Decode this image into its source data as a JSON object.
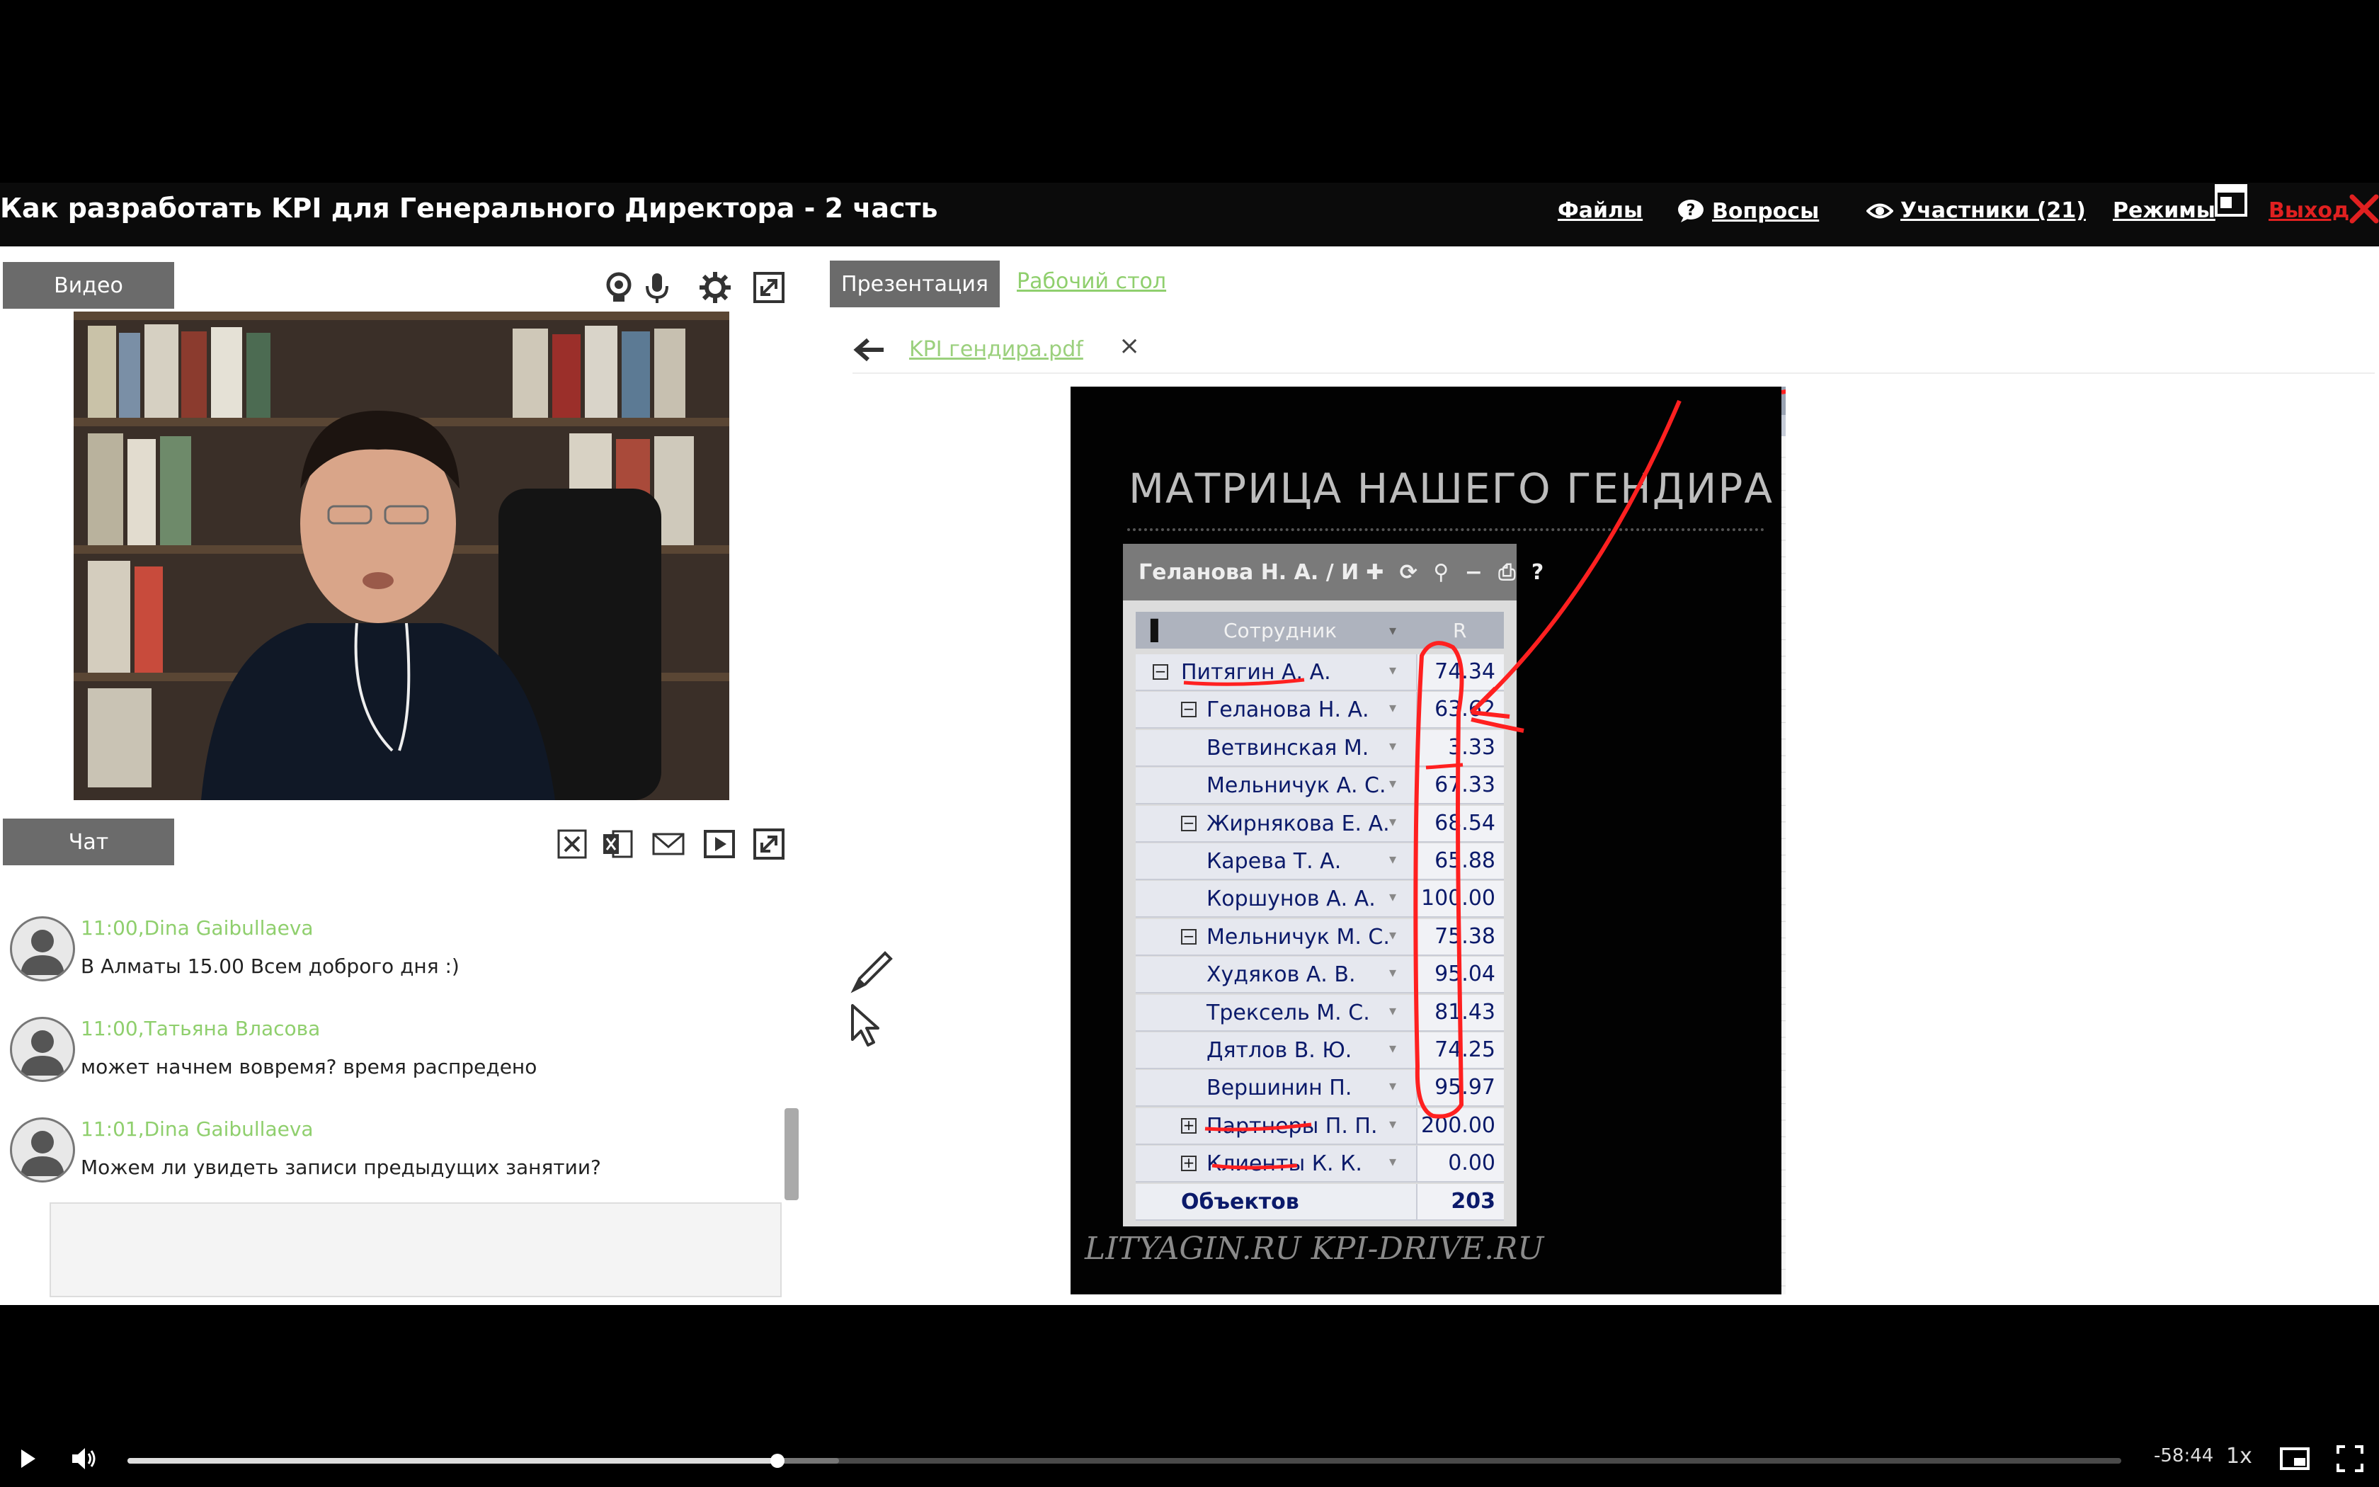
{
  "header": {
    "title": "Как разработать KPI для Генерального Директора - 2 часть",
    "files": "Файлы",
    "questions": "Вопросы",
    "participants": "Участники (21)",
    "modes": "Режимы",
    "exit": "Выход"
  },
  "video_panel": {
    "tab": "Видео"
  },
  "chat": {
    "tab": "Чат",
    "messages": [
      {
        "time": "11:00,",
        "author": "Dina Gaibullaeva",
        "text": "В Алматы 15.00 Всем доброго дня :)"
      },
      {
        "time": "11:00,",
        "author": "Татьяна Власова",
        "text": "может начнем вовремя? время распредено"
      },
      {
        "time": "11:01,",
        "author": "Dina Gaibullaeva",
        "text": "Можем ли увидеть записи предыдущих занятии?"
      }
    ]
  },
  "presentation": {
    "tab_presentation": "Презентация",
    "tab_desktop": "Рабочий стол",
    "file_name": "KPI гендира.pdf",
    "slide": {
      "title": "МАТРИЦА НАШЕГО ГЕНДИРА",
      "matrix_header": "Геланова Н. А. / И",
      "col_employee": "Сотрудник",
      "col_r": "R",
      "rows": [
        {
          "name": "Питягин А. А.",
          "value": "74.34"
        },
        {
          "name": "Геланова Н. А.",
          "value": "63.62"
        },
        {
          "name": "Ветвинская М.",
          "value": "3.33"
        },
        {
          "name": "Мельничук А. С.",
          "value": "67.33"
        },
        {
          "name": "Жирнякова Е. А.",
          "value": "68.54"
        },
        {
          "name": "Карева Т. А.",
          "value": "65.88"
        },
        {
          "name": "Коршунов А. А.",
          "value": "100.00"
        },
        {
          "name": "Мельничук М. С.",
          "value": "75.38"
        },
        {
          "name": "Худяков А. В.",
          "value": "95.04"
        },
        {
          "name": "Трексель М. С.",
          "value": "81.43"
        },
        {
          "name": "Дятлов В. Ю.",
          "value": "74.25"
        },
        {
          "name": "Вершинин П.",
          "value": "95.97"
        },
        {
          "name": "Партнеры П. П.",
          "value": "200.00"
        },
        {
          "name": "Клиенты К. К.",
          "value": "0.00"
        }
      ],
      "total_label": "Объектов",
      "total_value": "203",
      "footer": "LITYAGIN.RU  KPI-DRIVE.RU"
    }
  },
  "player": {
    "remaining": "-58:44",
    "speed": "1x",
    "progress_fraction": 0.326,
    "buffered_fraction": 0.357
  },
  "colors": {
    "accent_green": "#8fcf6d",
    "exit_red": "#e02020",
    "tab_gray": "#6b6b6b",
    "annotation_red": "#ff2020"
  }
}
